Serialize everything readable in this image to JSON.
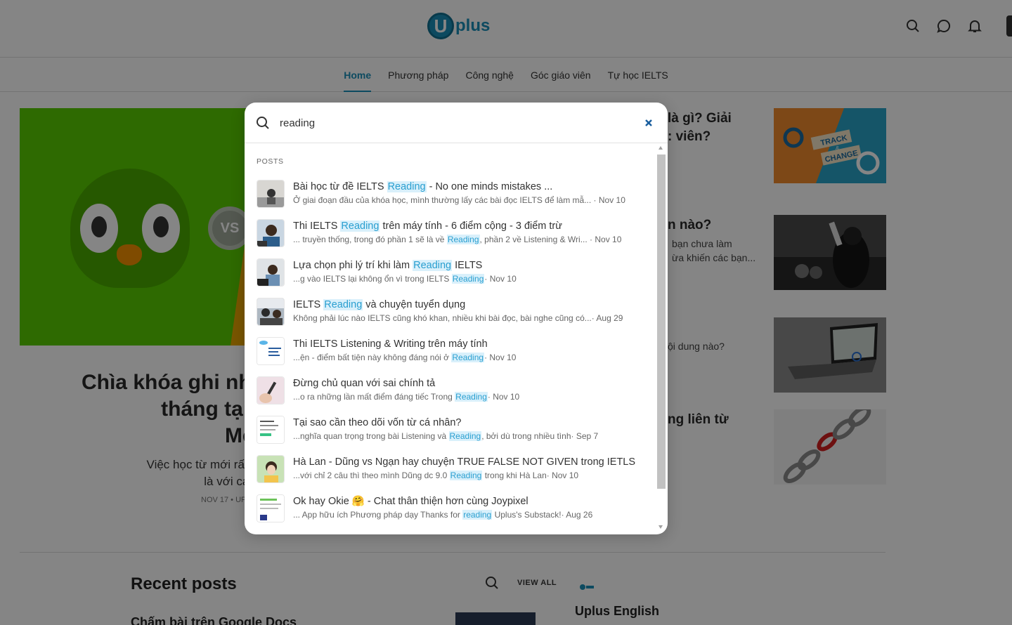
{
  "brand": {
    "logo_letter": "U",
    "logo_text": "plus"
  },
  "nav": {
    "items": [
      {
        "label": "Home",
        "active": true
      },
      {
        "label": "Phương pháp"
      },
      {
        "label": "Công nghệ"
      },
      {
        "label": "Góc giáo viên"
      },
      {
        "label": "Tự học IELTS"
      }
    ]
  },
  "hero": {
    "badge": "VS",
    "title": "Chìa khóa ghi nhớ 5                        ",
    "title_line2": "tháng tại Uplus - L",
    "title_line3": "Memr",
    "subtitle_line1": "Việc học từ mới rất gian nan, khó, dễ nả",
    "subtitle_line2": "là với các bạn vớn",
    "meta": "NOV 17 • UP"
  },
  "side_articles": [
    {
      "title_a": "là gì? Giải",
      "title_b": ": viên?"
    },
    {
      "title": "n nào?",
      "sub_a": "bạn chưa làm",
      "sub_b": "ừa khiến các bạn..."
    },
    {
      "sub": "ội dung nào?"
    },
    {
      "title": "ng liên từ"
    }
  ],
  "thumbs": {
    "track_change": {
      "line1": "TRACK",
      "amp": "&",
      "line2": "CHANGE"
    }
  },
  "recent": {
    "title": "Recent posts",
    "view_all": "VIEW ALL",
    "first_item": "Chấm bài trên Google Docs",
    "side_name": "Uplus English"
  },
  "search": {
    "query": "reading",
    "section_label": "POSTS",
    "results": [
      {
        "title_pre": "Bài học từ đề IELTS ",
        "title_hl": "Reading",
        "title_post": " - No one minds mistakes ...",
        "snip_pre": "Ở giai đoạn đầu của khóa học, mình thường lấy các bài đọc IELTS để làm mẫ...",
        "snip_hl": "",
        "snip_post": "",
        "date": " · Nov 10"
      },
      {
        "title_pre": "Thi IELTS ",
        "title_hl": "Reading",
        "title_post": " trên máy tính - 6 điểm cộng - 3 điểm trừ",
        "snip_pre": "... truyền thống, trong đó phần 1 sẽ là về ",
        "snip_hl": "Reading",
        "snip_post": ", phần 2 về Listening & Wri...",
        "date": " · Nov 10"
      },
      {
        "title_pre": "Lựa chọn phi lý trí khi làm ",
        "title_hl": "Reading",
        "title_post": " IELTS",
        "snip_pre": "...g vào IELTS lại không ổn vì trong IELTS ",
        "snip_hl": "Reading",
        "snip_post": "",
        "date": "· Nov 10"
      },
      {
        "title_pre": "IELTS ",
        "title_hl": "Reading",
        "title_post": " và chuyện tuyển dụng",
        "snip_pre": "Không phải lúc nào IELTS cũng khó khan, nhiều khi bài đọc, bài nghe cũng có...",
        "snip_hl": "",
        "snip_post": "",
        "date": "· Aug 29"
      },
      {
        "title_pre": "Thi IELTS Listening & Writing trên máy tính",
        "title_hl": "",
        "title_post": "",
        "snip_pre": "...ện - điểm bất tiện này không đáng nói ở ",
        "snip_hl": "Reading",
        "snip_post": "",
        "date": "· Nov 10"
      },
      {
        "title_pre": "Đừng chủ quan với sai chính tả",
        "title_hl": "",
        "title_post": "",
        "snip_pre": "...o ra những lần mất điểm đáng tiếc Trong ",
        "snip_hl": "Reading",
        "snip_post": "",
        "date": "· Nov 10"
      },
      {
        "title_pre": "Tại sao cần theo dõi vốn từ cá nhân?",
        "title_hl": "",
        "title_post": "",
        "snip_pre": "...nghĩa quan trọng trong bài Listening và ",
        "snip_hl": "Reading",
        "snip_post": ", bởi dù trong nhiều tình",
        "date": "· Sep 7"
      },
      {
        "title_pre": "Hà Lan - Dũng vs Ngạn hay chuyện TRUE FALSE NOT GIVEN trong IETLS",
        "title_hl": "",
        "title_post": "",
        "snip_pre": "...với chỉ 2 câu thì theo mình Dũng dc 9.0 ",
        "snip_hl": "Reading",
        "snip_post": " trong khi Hà Lan",
        "date": "· Nov 10"
      },
      {
        "title_pre": "Ok hay Okie 🤗 - Chat thân thiện hơn cùng Joypixel",
        "title_hl": "",
        "title_post": "",
        "snip_pre": "... App hữu ích Phương pháp dạy Thanks for ",
        "snip_hl": "reading",
        "snip_post": " Uplus's Substack!",
        "date": "· Aug 26"
      }
    ]
  },
  "colors": {
    "accent": "#1a8fb8",
    "highlight_text": "#2a9fd0",
    "highlight_bg": "#d9f0fb",
    "hero_green": "#58cc02",
    "hero_orange": "#e8a500"
  }
}
